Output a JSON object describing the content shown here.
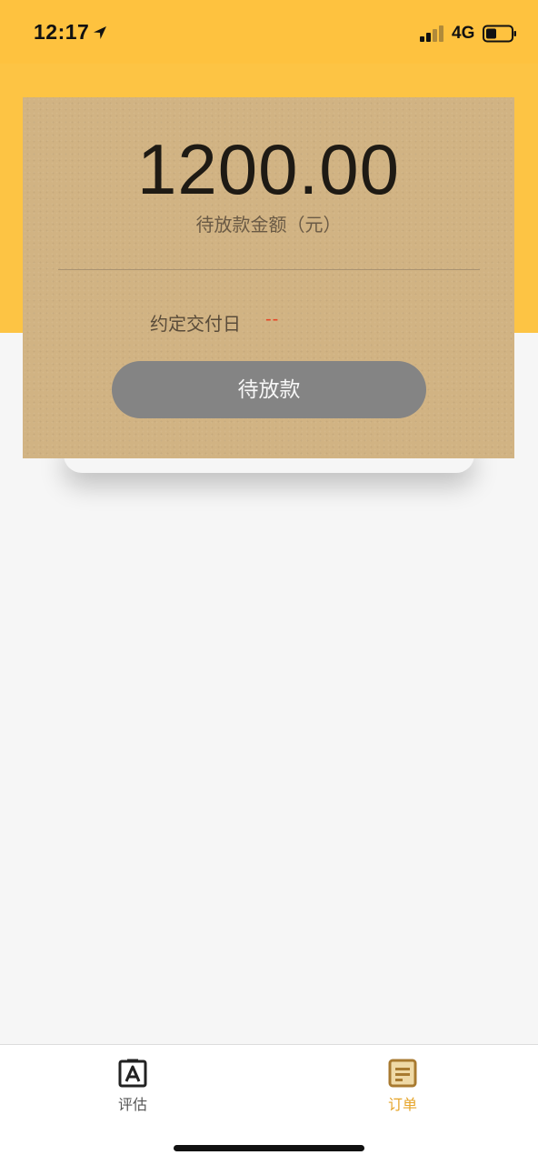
{
  "status_bar": {
    "time": "12:17",
    "network": "4G",
    "location_icon": "location-arrow-icon",
    "signal_icon": "cellular-signal-icon",
    "battery_icon": "battery-icon"
  },
  "colors": {
    "header_yellow": "#fdc444",
    "card_tan": "#d1b383",
    "button_gray": "#848484",
    "accent_orange": "#e6a52a",
    "date_placeholder_red": "#e64525"
  },
  "card": {
    "amount": "1200.00",
    "amount_label": "待放款金额（元）",
    "date_label": "约定交付日",
    "date_value": "--",
    "status_button_label": "待放款"
  },
  "tab_bar": {
    "items": [
      {
        "label": "评估",
        "icon": "estimate-icon",
        "active": false
      },
      {
        "label": "订单",
        "icon": "orders-icon",
        "active": true
      }
    ]
  }
}
